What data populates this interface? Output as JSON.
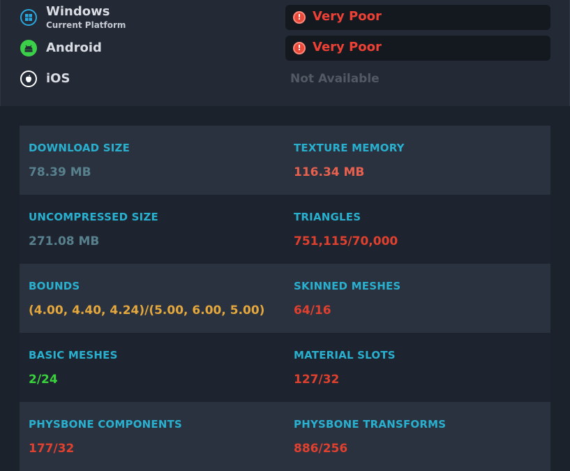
{
  "platforms": [
    {
      "name": "Windows",
      "subtitle": "Current Platform",
      "icon": "windows-icon",
      "rating": "Very Poor",
      "color": "#2aa8e0"
    },
    {
      "name": "Android",
      "subtitle": "",
      "icon": "android-icon",
      "rating": "Very Poor",
      "color": "#3ccf4a"
    },
    {
      "name": "iOS",
      "subtitle": "",
      "icon": "apple-icon",
      "rating": "Not Available",
      "color": "#ffffff"
    }
  ],
  "warning_icon": "exclamation-icon",
  "colors": {
    "label": "#2ab0cf",
    "neutral": "#58818d",
    "bad": "#e0402e",
    "poor": "#e8614e",
    "medium": "#e5a83c",
    "good": "#3ad23c"
  },
  "stats": [
    {
      "left": {
        "label": "DOWNLOAD SIZE",
        "value": "78.39 MB",
        "color": "#58818d"
      },
      "right": {
        "label": "TEXTURE MEMORY",
        "value": "116.34 MB",
        "color": "#e8614e"
      }
    },
    {
      "left": {
        "label": "UNCOMPRESSED SIZE",
        "value": "271.08 MB",
        "color": "#58818d"
      },
      "right": {
        "label": "TRIANGLES",
        "value": "751,115/70,000",
        "color": "#e0402e"
      }
    },
    {
      "left": {
        "label": "BOUNDS",
        "value": "(4.00, 4.40, 4.24)/(5.00, 6.00, 5.00)",
        "color": "#e5a83c"
      },
      "right": {
        "label": "SKINNED MESHES",
        "value": "64/16",
        "color": "#e0402e"
      }
    },
    {
      "left": {
        "label": "BASIC MESHES",
        "value": "2/24",
        "color": "#3ad23c"
      },
      "right": {
        "label": "MATERIAL SLOTS",
        "value": "127/32",
        "color": "#e0402e"
      }
    },
    {
      "left": {
        "label": "PHYSBONE COMPONENTS",
        "value": "177/32",
        "color": "#e0402e"
      },
      "right": {
        "label": "PHYSBONE TRANSFORMS",
        "value": "886/256",
        "color": "#e0402e"
      }
    }
  ]
}
